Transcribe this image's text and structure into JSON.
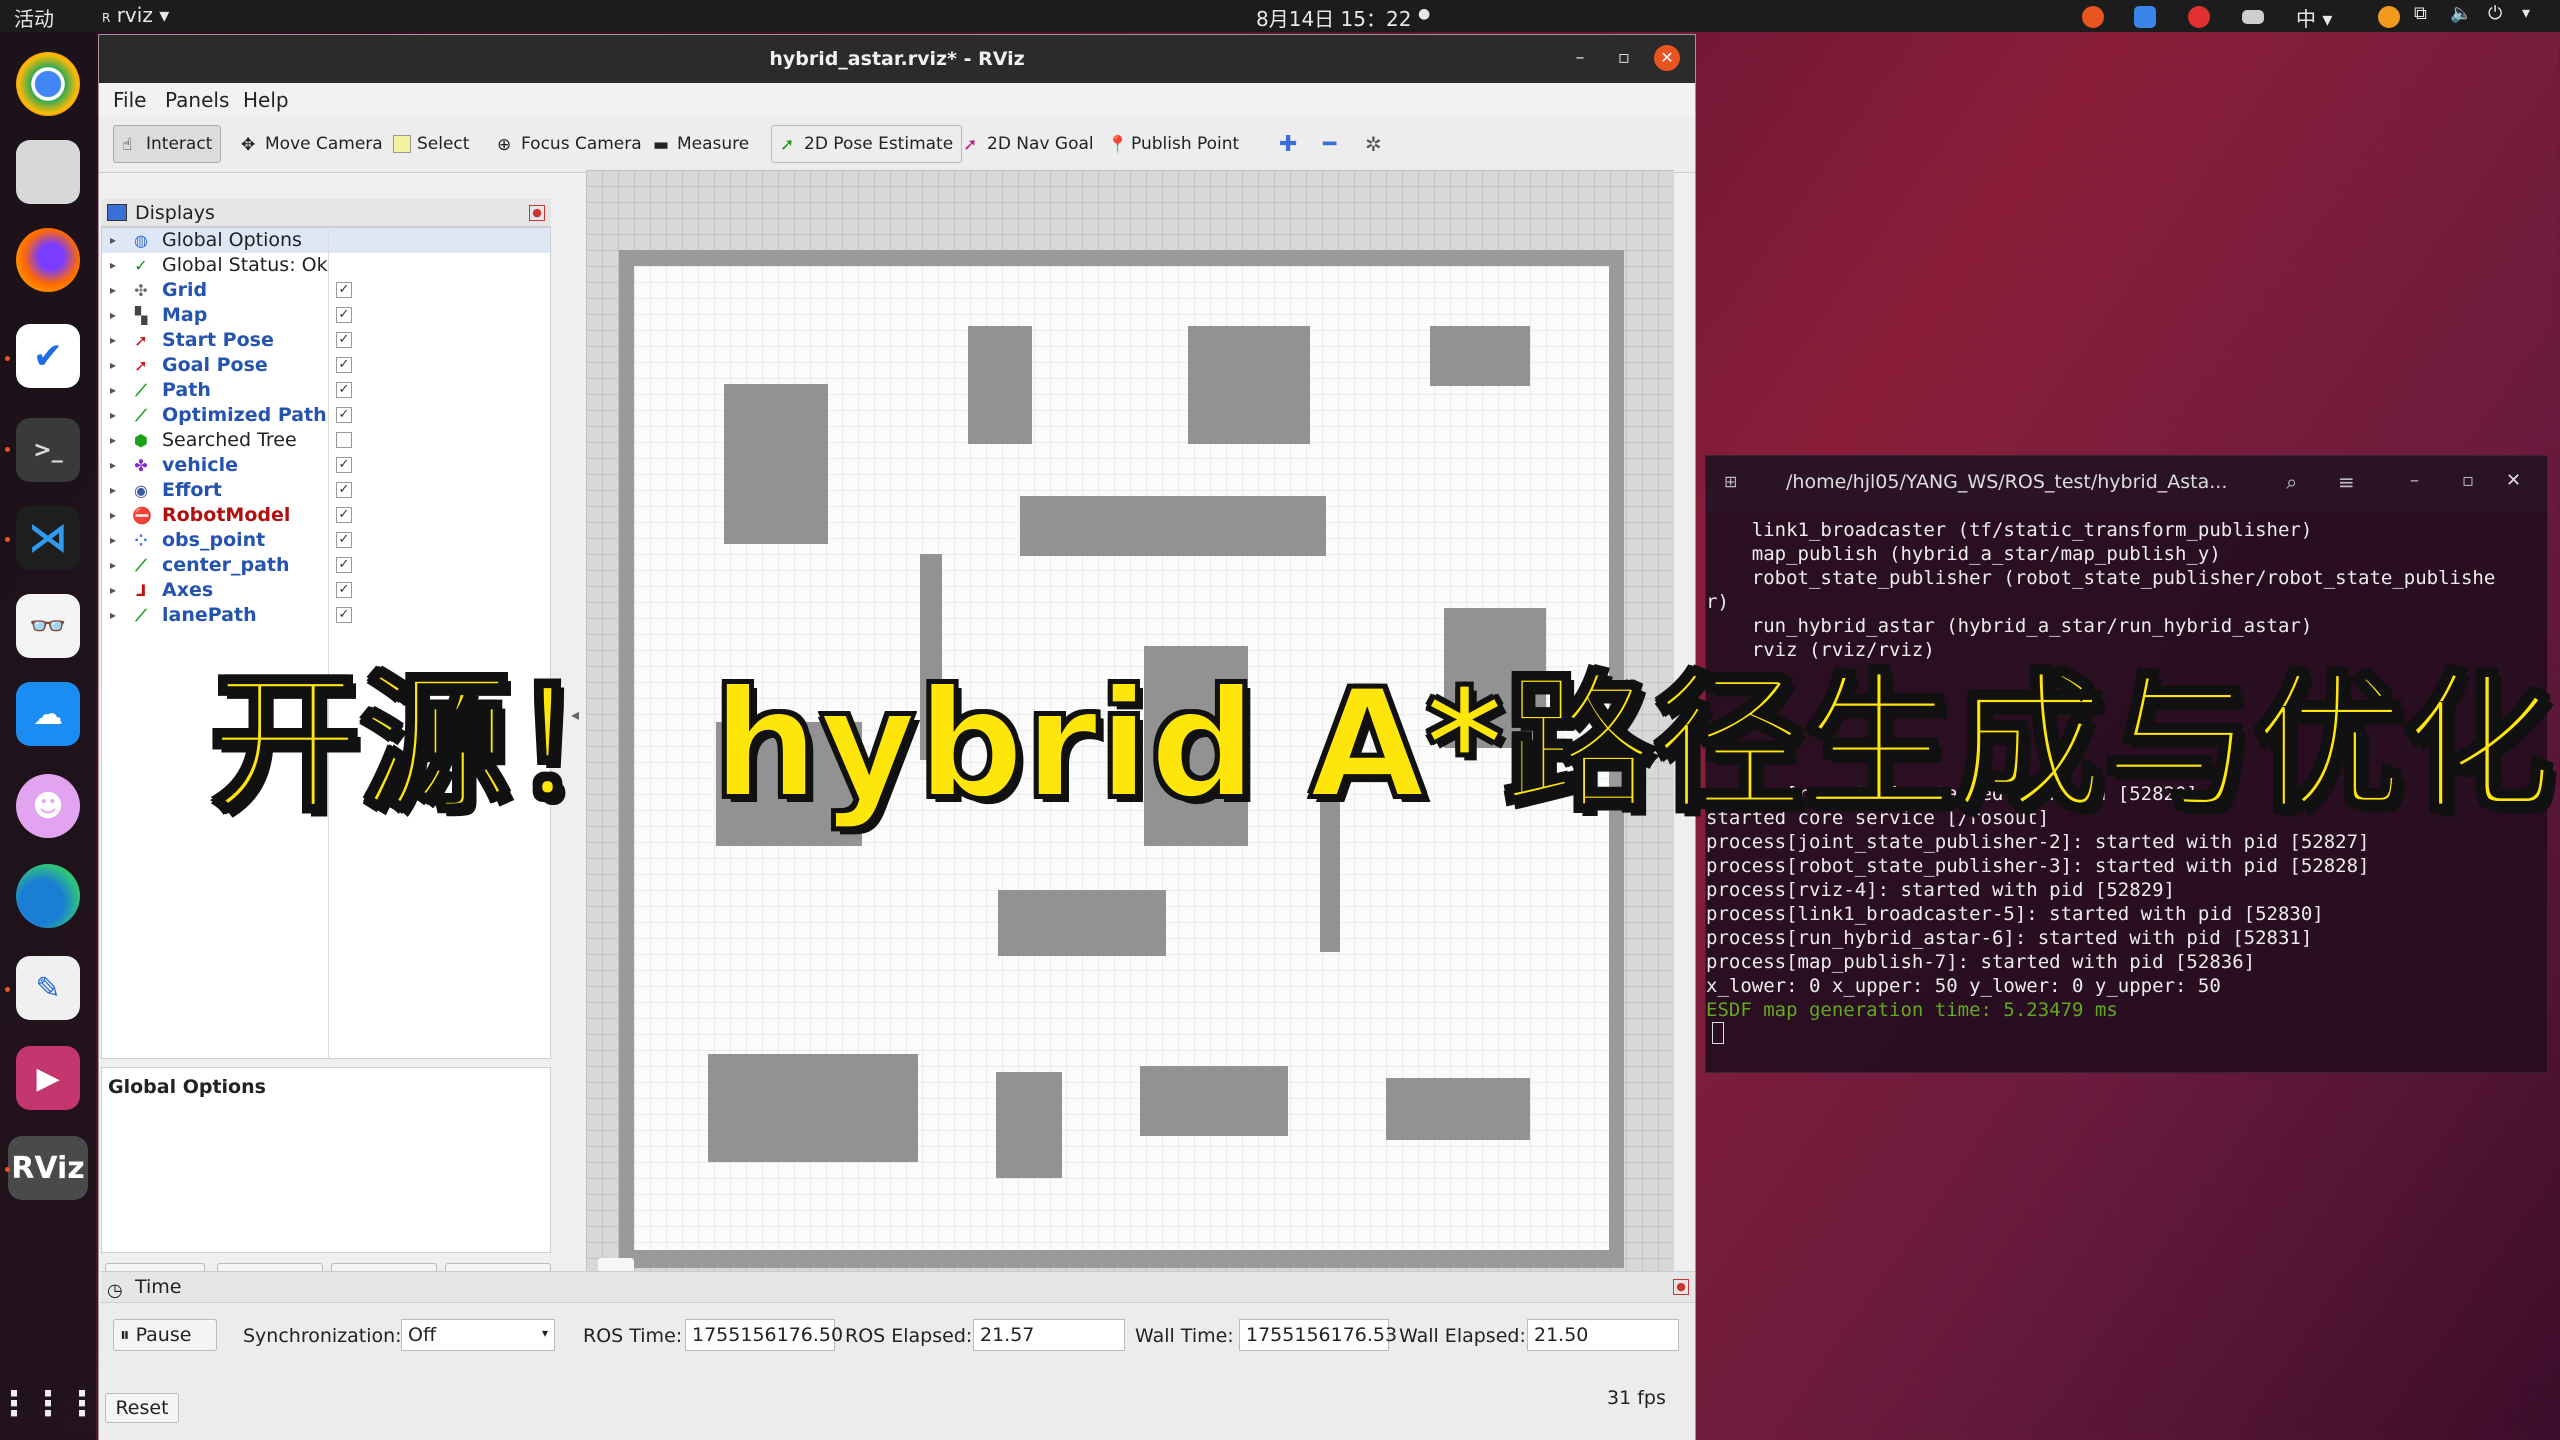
{
  "topbar": {
    "activities": "活动",
    "app_menu": "rviz",
    "clock": "8月14日 15：22",
    "input_method": "中"
  },
  "dock": {
    "items": [
      "chrome",
      "files",
      "firefox",
      "mail-client",
      "terminal",
      "vscode",
      "document-viewer",
      "cloud-drive",
      "chat-cat",
      "edge",
      "text-editor",
      "media-player",
      "RViz"
    ],
    "apps_grid": "apps-grid-icon"
  },
  "rviz": {
    "title": "hybrid_astar.rviz* - RViz",
    "menu": {
      "file": "File",
      "panels": "Panels",
      "help": "Help"
    },
    "toolbar": {
      "interact": "Interact",
      "move_camera": "Move Camera",
      "select": "Select",
      "focus_camera": "Focus Camera",
      "measure": "Measure",
      "pose_estimate": "2D Pose Estimate",
      "nav_goal": "2D Nav Goal",
      "publish_point": "Publish Point"
    },
    "displays": {
      "header": "Displays",
      "items": [
        {
          "label": "Global Options",
          "checked": ""
        },
        {
          "label": "Global Status: Ok",
          "checked": ""
        },
        {
          "label": "Grid",
          "checked": "✓"
        },
        {
          "label": "Map",
          "checked": "✓"
        },
        {
          "label": "Start Pose",
          "checked": "✓"
        },
        {
          "label": "Goal Pose",
          "checked": "✓"
        },
        {
          "label": "Path",
          "checked": "✓"
        },
        {
          "label": "Optimized Path",
          "checked": "✓"
        },
        {
          "label": "Searched Tree",
          "checked": ""
        },
        {
          "label": "vehicle",
          "checked": "✓"
        },
        {
          "label": "Effort",
          "checked": "✓"
        },
        {
          "label": "RobotModel",
          "checked": "✓"
        },
        {
          "label": "obs_point",
          "checked": "✓"
        },
        {
          "label": "center_path",
          "checked": "✓"
        },
        {
          "label": "Axes",
          "checked": "✓"
        },
        {
          "label": "lanePath",
          "checked": "✓"
        }
      ],
      "description_title": "Global Options",
      "buttons": {
        "add": "Add",
        "duplicate": "Duplicate",
        "remove": "Remove",
        "rename": "Rename"
      }
    },
    "time": {
      "header": "Time",
      "pause": "Pause",
      "sync_label": "Synchronization:",
      "sync_value": "Off",
      "ros_time_label": "ROS Time:",
      "ros_time": "1755156176.50",
      "ros_elapsed_label": "ROS Elapsed:",
      "ros_elapsed": "21.57",
      "wall_time_label": "Wall Time:",
      "wall_time": "1755156176.53",
      "wall_elapsed_label": "Wall Elapsed:",
      "wall_elapsed": "21.50",
      "reset": "Reset",
      "fps": "31 fps"
    }
  },
  "terminal": {
    "title": "/home/hjl05/YANG_WS/ROS_test/hybrid_Asta...",
    "lines": [
      "    link1_broadcaster (tf/static_transform_publisher)",
      "    map_publish (hybrid_a_star/map_publish_y)",
      "    robot_state_publisher (robot_state_publisher/robot_state_publishe",
      "r)",
      "    run_hybrid_astar (hybrid_a_star/run_hybrid_astar)",
      "    rviz (rviz/rviz)",
      "",
      "",
      "",
      "",
      "",
      "process[rosout-1]: started with pid [52820]",
      "started core service [/rosout]",
      "process[joint_state_publisher-2]: started with pid [52827]",
      "process[robot_state_publisher-3]: started with pid [52828]",
      "process[rviz-4]: started with pid [52829]",
      "process[link1_broadcaster-5]: started with pid [52830]",
      "process[run_hybrid_astar-6]: started with pid [52831]",
      "process[map_publish-7]: started with pid [52836]",
      "x_lower: 0 x_upper: 50 y_lower: 0 y_upper: 50"
    ],
    "green_line": "ESDF map generation time: 5.23479 ms"
  },
  "overlay": {
    "caption": "开源！ hybrid A*路径生成与优化"
  },
  "colors": {
    "accent": "#e95420",
    "caption_fill": "#ffe60a",
    "obstacle": "#929292",
    "terminal_bg": "#260e20"
  }
}
